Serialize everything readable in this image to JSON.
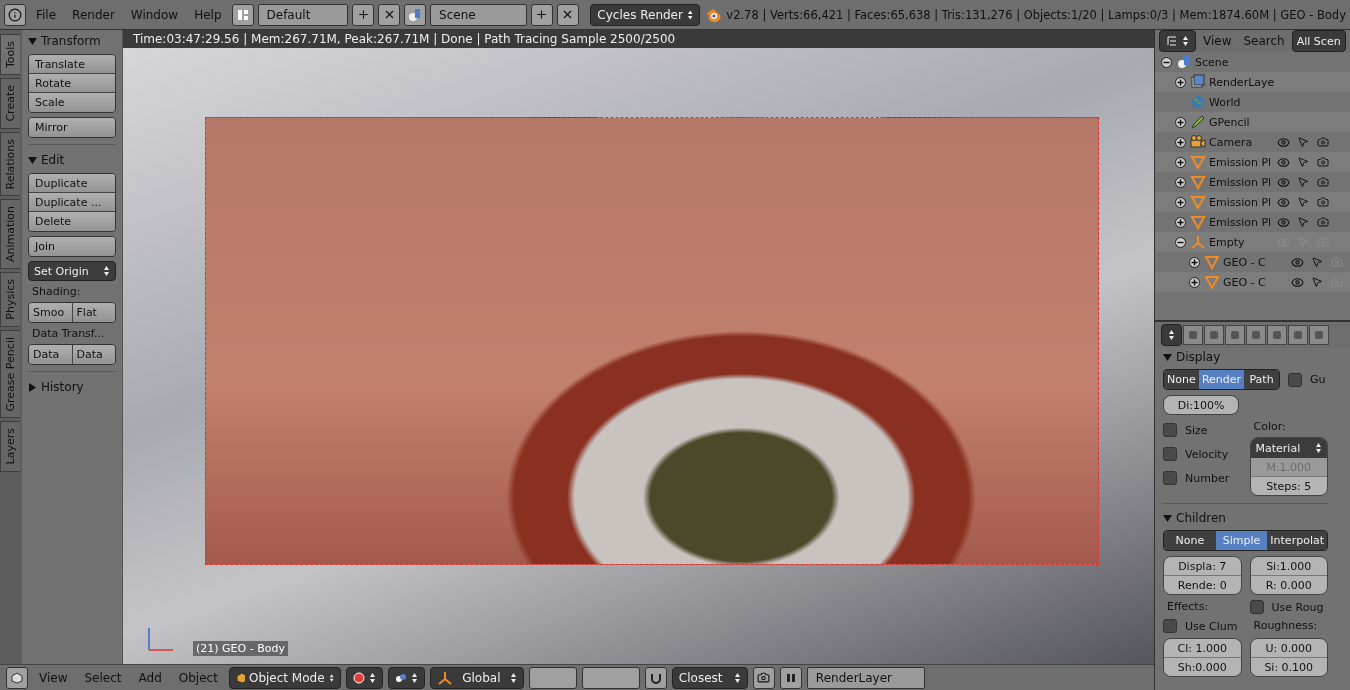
{
  "top_bar": {
    "menu": [
      "File",
      "Render",
      "Window",
      "Help"
    ],
    "layout": "Default",
    "scene": "Scene",
    "engine": "Cycles Render",
    "stats": "v2.78 | Verts:66,421 | Faces:65,638 | Tris:131,276 | Objects:1/20 | Lamps:0/3 | Mem:1874.60M | GEO - Body"
  },
  "tool_tabs": [
    {
      "label": "Tools",
      "selected": true
    },
    {
      "label": "Create",
      "selected": false
    },
    {
      "label": "Relations",
      "selected": false
    },
    {
      "label": "Animation",
      "selected": false
    },
    {
      "label": "Physics",
      "selected": false
    },
    {
      "label": "Grease Pencil",
      "selected": false
    },
    {
      "label": "Layers",
      "selected": false
    }
  ],
  "tool_panel": [
    {
      "title": "Transform",
      "expanded": true,
      "items": [
        {
          "kind": "buttons",
          "labels": [
            "Translate",
            "Rotate",
            "Scale"
          ]
        },
        {
          "kind": "buttons",
          "labels": [
            "Mirror"
          ]
        }
      ]
    },
    {
      "title": "Edit",
      "expanded": true,
      "items": [
        {
          "kind": "buttons",
          "labels": [
            "Duplicate",
            "Duplicate ...",
            "Delete"
          ]
        },
        {
          "kind": "buttons",
          "labels": [
            "Join"
          ]
        },
        {
          "kind": "dropdown",
          "labels": [
            "Set Origin"
          ]
        },
        {
          "kind": "label",
          "labels": [
            "Shading:"
          ]
        },
        {
          "kind": "pair",
          "labels": [
            "Smoo",
            "Flat"
          ]
        },
        {
          "kind": "label",
          "labels": [
            "Data Transf..."
          ]
        },
        {
          "kind": "pair",
          "labels": [
            "Data",
            "Data"
          ]
        }
      ]
    },
    {
      "title": "History",
      "expanded": false
    }
  ],
  "viewport": {
    "render_info": "Time:03:47:29.56 | Mem:267.71M, Peak:267.71M | Done | Path Tracing Sample 2500/2500",
    "object_label": "(21) GEO - Body"
  },
  "outliner": {
    "menu": [
      "View",
      "Search"
    ],
    "filter": "All Scen",
    "tree": [
      {
        "name": "Scene",
        "kind": "scene",
        "expanded": true,
        "children": [
          {
            "name": "RenderLaye",
            "kind": "renderlayer",
            "expanded": false
          },
          {
            "name": "World",
            "kind": "world"
          },
          {
            "name": "GPencil",
            "kind": "gpencil",
            "expanded": false
          },
          {
            "name": "Camera",
            "kind": "camera",
            "expanded": false,
            "visible": true,
            "selectable": true,
            "renderable": true
          },
          {
            "name": "Emission Pl",
            "kind": "mesh",
            "expanded": false,
            "visible": true,
            "selectable": true,
            "renderable": true
          },
          {
            "name": "Emission Pl",
            "kind": "mesh",
            "expanded": false,
            "visible": true,
            "selectable": true,
            "renderable": true
          },
          {
            "name": "Emission Pl",
            "kind": "mesh",
            "expanded": false,
            "visible": true,
            "selectable": true,
            "renderable": true
          },
          {
            "name": "Emission Pl",
            "kind": "mesh",
            "expanded": false,
            "visible": true,
            "selectable": true,
            "renderable": true
          },
          {
            "name": "Empty",
            "kind": "empty",
            "expanded": true,
            "visible": false,
            "selectable": false,
            "renderable": false,
            "children": [
              {
                "name": "GEO - C",
                "kind": "mesh",
                "expanded": false,
                "visible": true,
                "selectable": true,
                "renderable": false
              },
              {
                "name": "GEO - C",
                "kind": "mesh",
                "expanded": false,
                "visible": true,
                "selectable": true,
                "renderable": false
              }
            ]
          }
        ]
      }
    ]
  },
  "properties": {
    "display": {
      "title": "Display",
      "modes": [
        {
          "label": "None",
          "selected": false
        },
        {
          "label": "Render",
          "selected": true
        },
        {
          "label": "Path",
          "selected": false
        }
      ],
      "guide": {
        "label": "Gu",
        "checked": false
      },
      "amount": "Di:100%",
      "checks": [
        {
          "label": "Size",
          "checked": false
        },
        {
          "label": "Velocity",
          "checked": false
        },
        {
          "label": "Number",
          "checked": false
        }
      ],
      "color_label": "Color:",
      "color_mode": "Material",
      "fields": [
        {
          "text": "M:1.000",
          "disabled": true
        },
        {
          "text": "Steps:  5",
          "disabled": false
        }
      ]
    },
    "children": {
      "title": "Children",
      "modes": [
        {
          "label": "None",
          "selected": false
        },
        {
          "label": "Simple",
          "selected": true
        },
        {
          "label": "Interpolat",
          "selected": false
        }
      ],
      "left_fields": [
        "Displa: 7",
        "Rende: 0"
      ],
      "right_fields": [
        "Si:1.000",
        "R: 0.000"
      ],
      "effects_label": "Effects:",
      "use_rough": {
        "label": "Use Roug",
        "checked": false
      },
      "use_clump": {
        "label": "Use Clum",
        "checked": false
      },
      "roughness_label": "Roughness:",
      "clump_fields": [
        "Cl: 1.000",
        "Sh:0.000"
      ],
      "rough_fields": [
        "U: 0.000",
        "Si: 0.100"
      ]
    }
  },
  "bottom_bar": {
    "menu": [
      "View",
      "Select",
      "Add",
      "Object"
    ],
    "mode": "Object Mode",
    "orientation": "Global",
    "snap": "Closest",
    "layer": "RenderLayer"
  }
}
